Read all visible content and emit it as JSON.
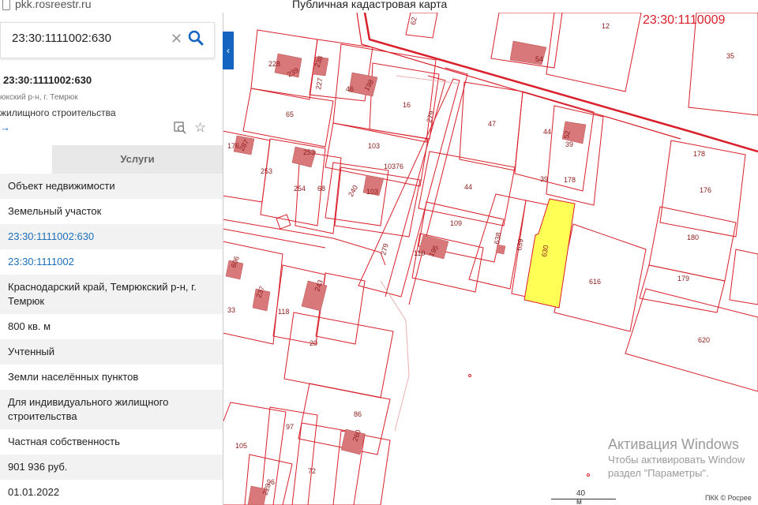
{
  "browser": {
    "url": "pkk.rosreestr.ru",
    "page_title": "Публичная кадастровая карта"
  },
  "search": {
    "value": "23:30:1111002:630",
    "clear_icon": "close-icon",
    "search_icon": "search-icon"
  },
  "object": {
    "number": "23:30:1111002:630",
    "address_short": "юкский р-н, г. Темрюк",
    "purpose_short": "жилищного строительства",
    "link_arrow": "→"
  },
  "tabs": [
    {
      "label": ""
    },
    {
      "label": "Услуги"
    }
  ],
  "properties": [
    {
      "value": "Объект недвижимости",
      "type": "text"
    },
    {
      "value": "Земельный участок",
      "type": "text"
    },
    {
      "value": "23:30:1111002:630",
      "type": "link"
    },
    {
      "value": "23:30:1111002",
      "type": "link"
    },
    {
      "value": "Краснодарский край, Темрюкский р-н, г. Темрюк",
      "type": "text"
    },
    {
      "value": "800 кв. м",
      "type": "text"
    },
    {
      "value": "Учтенный",
      "type": "text"
    },
    {
      "value": "Земли населённых пунктов",
      "type": "text"
    },
    {
      "value": "Для индивидуального жилищного строительства",
      "type": "text"
    },
    {
      "value": "Частная собственность",
      "type": "text"
    },
    {
      "value": "901 936 руб.",
      "type": "text"
    },
    {
      "value": "01.01.2022",
      "type": "text"
    }
  ],
  "map": {
    "quarter_label": "23:30:1110009",
    "parcel_labels": [
      "12",
      "35",
      "62",
      "54",
      "228",
      "239",
      "238",
      "227",
      "46",
      "198",
      "16",
      "65",
      "279",
      "47",
      "44",
      "39",
      "52",
      "176",
      "287",
      "253",
      "103",
      "178",
      "176",
      "253",
      "254",
      "68",
      "240",
      "103",
      "10376",
      "44",
      "39",
      "178",
      "109",
      "110",
      "195",
      "638",
      "639",
      "630",
      "180",
      "279",
      "616",
      "606",
      "33",
      "237",
      "243",
      "179",
      "118",
      "20",
      "620",
      "86",
      "97",
      "105",
      "260",
      "96",
      "228",
      "72"
    ],
    "selected_parcel": "630",
    "colors": {
      "boundary": "#d81f2a",
      "selected_fill": "#ffff55",
      "building_fill": "#d9787a"
    }
  },
  "watermark": {
    "title": "Активация Windows",
    "line1": "Чтобы активировать Window",
    "line2": "раздел \"Параметры\"."
  },
  "scale_label": "40 м",
  "copyright": "ПКК © Росрее"
}
